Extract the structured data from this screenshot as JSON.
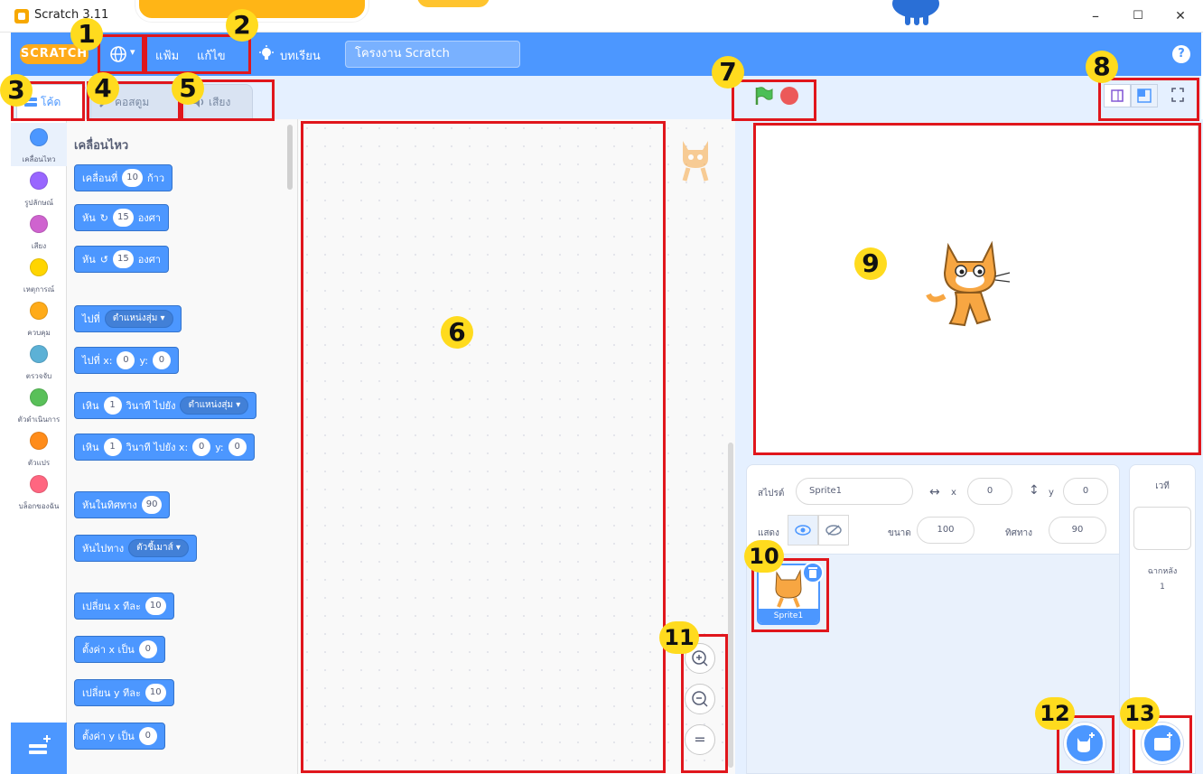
{
  "window": {
    "title": "Scratch 3.11",
    "minimize": "–",
    "maximize": "☐",
    "close": "✕"
  },
  "menubar": {
    "logo": "SCRATCH",
    "language_caret": "▾",
    "file_menu": "แฟ้ม",
    "edit_menu": "แก้ไข",
    "tutorials": "บทเรียน",
    "project_title": "โครงงาน Scratch",
    "help": "?"
  },
  "tabs": {
    "code": "โค้ด",
    "costumes": "คอสตูม",
    "sounds": "เสียง"
  },
  "categories": [
    {
      "label": "เคลื่อนไหว",
      "color": "#4c97ff"
    },
    {
      "label": "รูปลักษณ์",
      "color": "#9966ff"
    },
    {
      "label": "เสียง",
      "color": "#cf63cf"
    },
    {
      "label": "เหตุการณ์",
      "color": "#ffd500"
    },
    {
      "label": "ควบคุม",
      "color": "#ffab19"
    },
    {
      "label": "ตรวจจับ",
      "color": "#5cb1d6"
    },
    {
      "label": "ตัวดำเนินการ",
      "color": "#59c059"
    },
    {
      "label": "ตัวแปร",
      "color": "#ff8c1a"
    },
    {
      "label": "บล็อกของฉัน",
      "color": "#ff6680"
    }
  ],
  "palette": {
    "title": "เคลื่อนไหว",
    "blocks": {
      "move": {
        "pre": "เคลื่อนที่",
        "v1": "10",
        "post": "ก้าว"
      },
      "turn_right": {
        "pre": "หัน",
        "v1": "15",
        "post": "องศา"
      },
      "turn_left": {
        "pre": "หัน",
        "v1": "15",
        "post": "องศา"
      },
      "goto": {
        "pre": "ไปที่",
        "dd": "ตำแหน่งสุ่ม ▾"
      },
      "goto_xy": {
        "pre": "ไปที่ x:",
        "v1": "0",
        "mid": "y:",
        "v2": "0"
      },
      "glide": {
        "pre": "เหิน",
        "v1": "1",
        "mid": "วินาที ไปยัง",
        "dd": "ตำแหน่งสุ่ม ▾"
      },
      "glide_xy": {
        "pre": "เหิน",
        "v1": "1",
        "mid": "วินาที ไปยัง x:",
        "v2": "0",
        "mid2": "y:",
        "v3": "0"
      },
      "point_dir": {
        "pre": "หันในทิศทาง",
        "v1": "90"
      },
      "point_towards": {
        "pre": "หันไปทาง",
        "dd": "ตัวชี้เมาส์ ▾"
      },
      "change_x": {
        "pre": "เปลี่ยน x ทีละ",
        "v1": "10"
      },
      "set_x": {
        "pre": "ตั้งค่า x เป็น",
        "v1": "0"
      },
      "change_y": {
        "pre": "เปลี่ยน y ทีละ",
        "v1": "10"
      },
      "set_y": {
        "pre": "ตั้งค่า y เป็น",
        "v1": "0"
      }
    }
  },
  "zoom": {
    "in": "+",
    "out": "−",
    "reset": "="
  },
  "sprite_info": {
    "sprite_label": "สไปรต์",
    "sprite_name": "Sprite1",
    "x_label": "x",
    "x_value": "0",
    "y_label": "y",
    "y_value": "0",
    "show_label": "แสดง",
    "size_label": "ขนาด",
    "size_value": "100",
    "direction_label": "ทิศทาง",
    "direction_value": "90"
  },
  "sprite_tile": {
    "name": "Sprite1"
  },
  "stage_pane": {
    "title": "เวที",
    "backdrops_label": "ฉากหลัง",
    "backdrops_count": "1"
  },
  "annotations": [
    "1",
    "2",
    "3",
    "4",
    "5",
    "6",
    "7",
    "8",
    "9",
    "10",
    "11",
    "12",
    "13"
  ],
  "colors": {
    "accent": "#4c97ff",
    "highlight": "#e0161c",
    "badge": "#ffdb1e"
  }
}
